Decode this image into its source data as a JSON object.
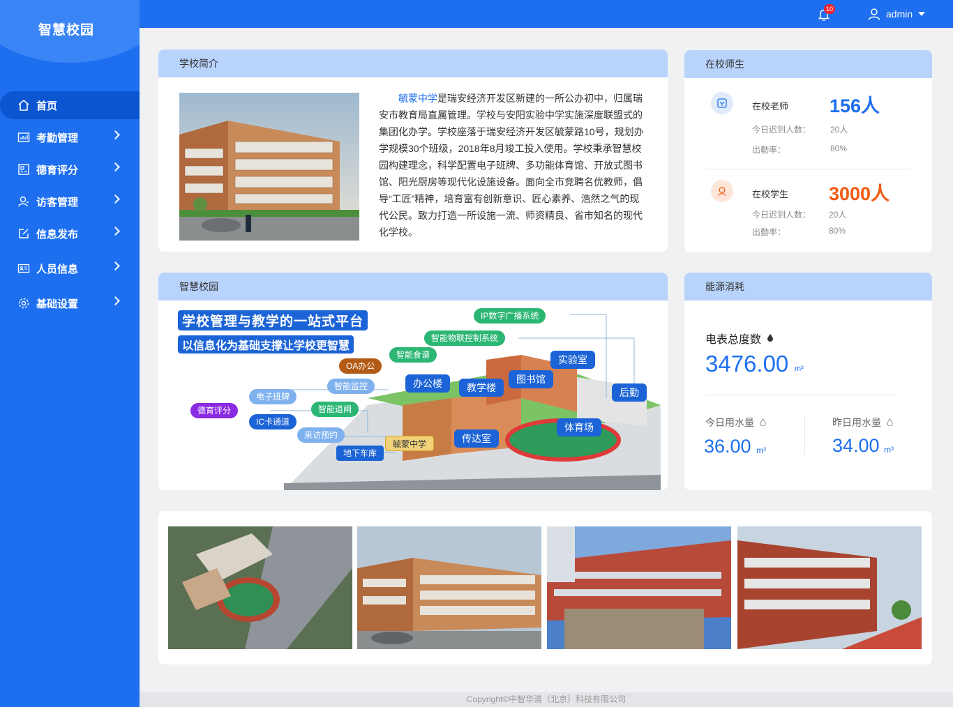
{
  "sidebar": {
    "title": "智慧校园",
    "items": [
      {
        "label": "首页",
        "icon": "home-icon",
        "active": true
      },
      {
        "label": "考勤管理",
        "icon": "chart-icon"
      },
      {
        "label": "德育评分",
        "icon": "score-icon"
      },
      {
        "label": "访客管理",
        "icon": "visitor-icon"
      },
      {
        "label": "信息发布",
        "icon": "edit-icon"
      },
      {
        "label": "人员信息",
        "icon": "id-card-icon"
      },
      {
        "label": "基础设置",
        "icon": "gear-icon"
      }
    ]
  },
  "header": {
    "notification_count": "10",
    "username": "admin"
  },
  "intro": {
    "title": "学校简介",
    "school_name": "毓蒙中学",
    "text": "是瑞安经济开发区新建的一所公办初中，归属瑞安市教育局直属管理。学校与安阳实验中学实施深度联盟式的集团化办学。学校座落于瑞安经济开发区毓蒙路10号，规划办学规模30个班级，2018年8月竣工投入使用。学校秉承智慧校园构建理念，科学配置电子班牌、多功能体育馆、开放式图书馆、阳光厨房等现代化设施设备。面向全市竞聘名优教师，倡导“工匠”精神，培育富有创新意识、匠心素养、浩然之气的现代公民。致力打造一所设施一流、师资精良、省市知名的现代化学校。"
  },
  "people": {
    "title": "在校师生",
    "teachers": {
      "label": "在校老师",
      "count": "156人",
      "late_label": "今日迟到人数：",
      "late_value": "20人",
      "rate_label": "出勤率：",
      "rate_value": "80%"
    },
    "students": {
      "label": "在校学生",
      "count": "3000人",
      "late_label": "今日迟到人数：",
      "late_value": "20人",
      "rate_label": "出勤率：",
      "rate_value": "80%"
    }
  },
  "campus": {
    "title": "智慧校园",
    "headline1": "学校管理与教学的一站式平台",
    "headline2": "以信息化为基础支撑让学校更智慧",
    "labels": {
      "ip_broadcast": "IP数字广播系统",
      "iot": "智能物联控制系统",
      "canteen": "智能食谱",
      "oa": "OA办公",
      "monitor": "智能监控",
      "class_board": "电子班牌",
      "moral": "德育评分",
      "ic": "IC卡通道",
      "gate": "智能道闸",
      "visit": "来访预约",
      "parking": "地下车库",
      "office": "办公楼",
      "teaching": "教学楼",
      "library": "图书馆",
      "lab": "实验室",
      "logistics": "后勤",
      "gym": "体育场",
      "guard": "传达室",
      "school": "毓蒙中学"
    }
  },
  "energy": {
    "title": "能源消耗",
    "meter_label": "电表总度数",
    "meter_value": "3476.00",
    "meter_unit": "m³",
    "today_label": "今日用水量",
    "today_value": "36.00",
    "today_unit": "m³",
    "yesterday_label": "昨日用水量",
    "yesterday_value": "34.00",
    "yesterday_unit": "m³"
  },
  "footer": {
    "copyright": "Copyright©中智华清（北京）科技有限公司"
  }
}
